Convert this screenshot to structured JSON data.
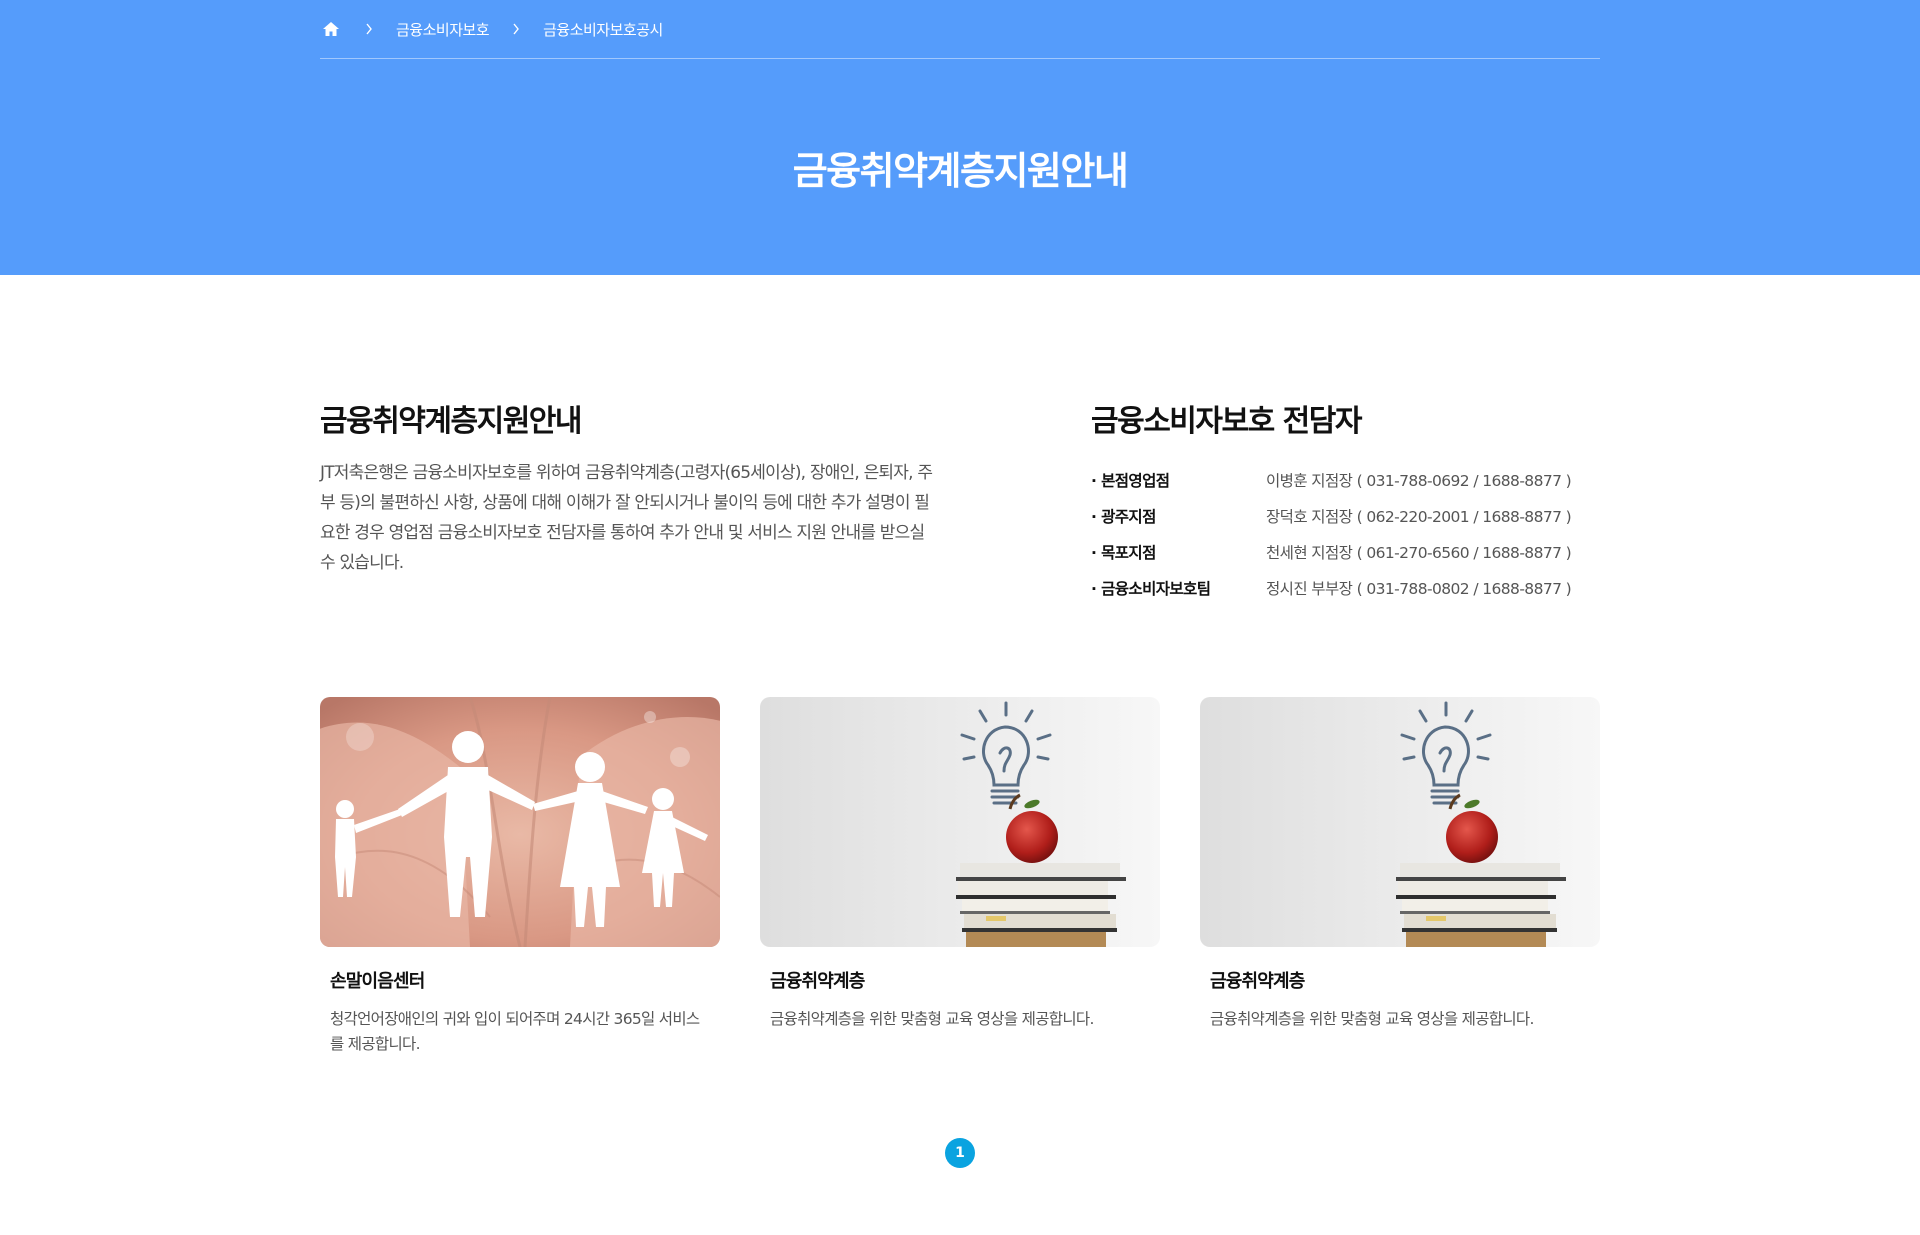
{
  "breadcrumb": {
    "home_icon": "home-icon",
    "items": [
      "금융소비자보호",
      "금융소비자보호공시"
    ]
  },
  "banner": {
    "title": "금융취약계층지원안내",
    "color": "#559cfb"
  },
  "intro": {
    "title": "금융취약계층지원안내",
    "text": "JT저축은행은 금융소비자보호를 위하여 금융취약계층(고령자(65세이상), 장애인, 은퇴자, 주부 등)의 불편하신 사항, 상품에 대해 이해가 잘 안되시거나 불이익 등에 대한 추가 설명이 필요한 경우 영업점 금융소비자보호 전담자를 통하여 추가 안내 및 서비스 지원 안내를 받으실 수 있습니다."
  },
  "staff": {
    "title": "금융소비자보호 전담자",
    "rows": [
      {
        "branch": "본점영업점",
        "contact": "이병훈 지점장 ( 031-788-0692 / 1688-8877 )"
      },
      {
        "branch": "광주지점",
        "contact": "장덕호 지점장 ( 062-220-2001 / 1688-8877 )"
      },
      {
        "branch": "목포지점",
        "contact": "천세현 지점장 ( 061-270-6560 / 1688-8877 )"
      },
      {
        "branch": "금융소비자보호팀",
        "contact": "정시진 부부장 ( 031-788-0802 / 1688-8877 )"
      }
    ]
  },
  "cards": [
    {
      "title": "손말이음센터",
      "desc": "청각언어장애인의 귀와 입이 되어주며 24시간 365일 서비스를 제공합니다.",
      "image": "paper-family-on-hands"
    },
    {
      "title": "금융취약계층",
      "desc": "금융취약계층을 위한 맞춤형 교육 영상을 제공합니다.",
      "image": "apple-on-books-lightbulb"
    },
    {
      "title": "금융취약계층",
      "desc": "금융취약계층을 위한 맞춤형 교육 영상을 제공합니다.",
      "image": "apple-on-books-lightbulb"
    }
  ],
  "pagination": {
    "current": "1",
    "accent": "#0aa3e0"
  }
}
